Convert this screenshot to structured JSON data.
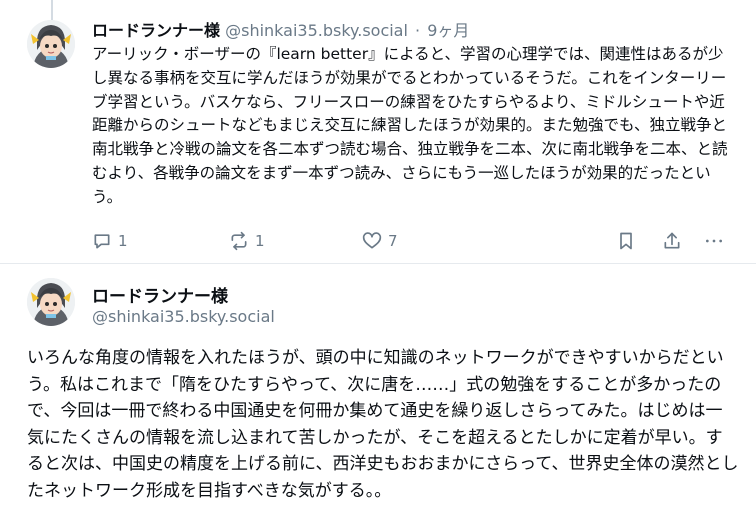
{
  "post1": {
    "display_name": "ロードランナー様",
    "handle": "@shinkai35.bsky.social",
    "separator": "·",
    "time": "9ヶ月",
    "text": "アーリック・ボーザーの『learn better』によると、学習の心理学では、関連性はあるが少し異なる事柄を交互に学んだほうが効果がでるとわかっているそうだ。これをインターリーブ学習という。バスケなら、フリースローの練習をひたすらやるより、ミドルシュートや近距離からのシュートなどもまじえ交互に練習したほうが効果的。また勉強でも、独立戦争と南北戦争と冷戦の論文を各二本ずつ読む場合、独立戦争を二本、次に南北戦争を二本、と読むより、各戦争の論文をまず一本ずつ読み、さらにもう一巡したほうが効果的だったという。",
    "actions": {
      "reply_count": "1",
      "repost_count": "1",
      "like_count": "7"
    }
  },
  "post2": {
    "display_name": "ロードランナー様",
    "handle": "@shinkai35.bsky.social",
    "text": "いろんな角度の情報を入れたほうが、頭の中に知識のネットワークができやすいからだという。私はこれまで「隋をひたすらやって、次に唐を……」式の勉強をすることが多かったので、今回は一冊で終わる中国通史を何冊か集めて通史を繰り返しさらってみた。はじめは一気にたくさんの情報を流し込まれて苦しかったが、そこを超えるとたしかに定着が早い。すると次は、中国史の精度を上げる前に、西洋史もおおまかにさらって、世界史全体の漠然としたネットワーク形成を目指すべきな気がする。。"
  },
  "icons": [
    "reply-icon",
    "repost-icon",
    "like-icon",
    "bookmark-icon",
    "share-icon",
    "more-icon"
  ],
  "colors": {
    "muted": "#6a7987",
    "text": "#0b0f14",
    "divider": "#e6eaee"
  }
}
